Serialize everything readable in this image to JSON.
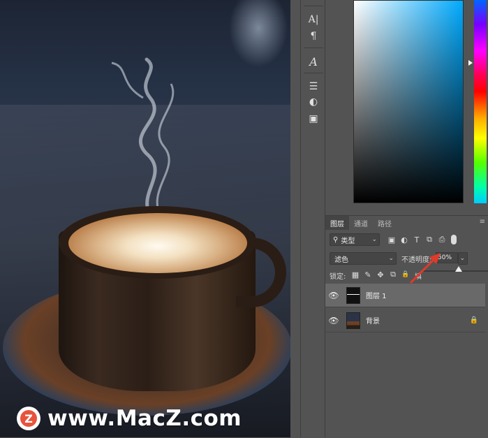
{
  "watermark": {
    "logo_letter": "Z",
    "text": "www.MacZ.com"
  },
  "toolstrip": {
    "icons": [
      "character-icon",
      "paragraph-icon",
      "glyphs-icon",
      "adjustments-icon",
      "styles-icon",
      "properties-icon"
    ],
    "glyphs": [
      "A|",
      "¶",
      "A",
      "☰",
      "◐",
      "▣"
    ]
  },
  "colors": {
    "accent_arrow": "#e03a2b",
    "hue_selected": "#00aaff"
  },
  "layers_panel": {
    "tabs": [
      "图层",
      "通道",
      "路径"
    ],
    "active_tab": "图层",
    "menu_glyph": "≡",
    "filter": {
      "label": "类型",
      "search_glyph": "⚲",
      "chevron": "⌄",
      "icons": [
        "▣",
        "◐",
        "T",
        "⧉",
        "⎙"
      ]
    },
    "blend_mode": "滤色",
    "opacity_label": "不透明度:",
    "opacity_value": "50%",
    "opacity_level": 0.5,
    "lock_label": "锁定:",
    "lock_icons": [
      "▦",
      "✎",
      "✥",
      "⧉",
      "🔒"
    ],
    "fill_label_partial": "填",
    "layers": [
      {
        "name": "图层 1",
        "visible": true,
        "selected": true,
        "locked": false
      },
      {
        "name": "背景",
        "visible": true,
        "selected": false,
        "locked": true
      }
    ]
  }
}
